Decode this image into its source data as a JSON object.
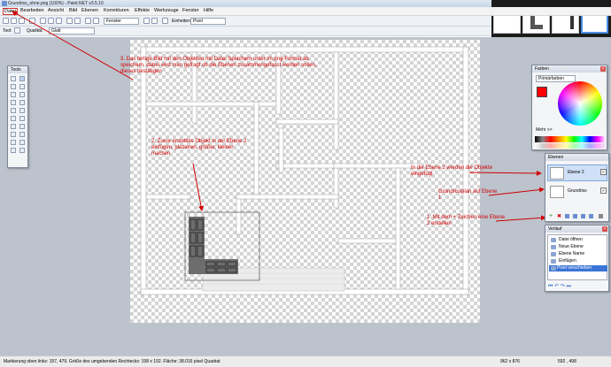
{
  "window": {
    "title": "Grundriss_ohne.png (100%) - Paint.NET v3.5.10"
  },
  "menu": [
    "Datei",
    "Bearbeiten",
    "Ansicht",
    "Bild",
    "Ebenen",
    "Korrekturen",
    "Effekte",
    "Werkzeuge",
    "Fenster",
    "Hilfe"
  ],
  "toolbar": {
    "view_combo": "Fenster",
    "units_label": "Einheiten:",
    "units_value": "Pixel"
  },
  "toolbar2": {
    "tool_label": "Tool:",
    "quality_label": "Qualität:",
    "quality_value": "Glatt"
  },
  "tools_panel": {
    "title": "Tools"
  },
  "colors_panel": {
    "title": "Farben",
    "mode": "Primärfarben",
    "more": "Mehr >>",
    "primary": "#ff0000",
    "secondary": "#000000"
  },
  "layers_panel": {
    "title": "Ebenen",
    "layers": [
      {
        "name": "Ebene 2",
        "checked": "✓"
      },
      {
        "name": "Grundriss",
        "checked": "✓"
      }
    ]
  },
  "history_panel": {
    "title": "Verlauf",
    "items": [
      "Datei öffnen",
      "Neue Ebene",
      "Ebene Name",
      "Einfügen",
      "Pixel verschieben"
    ]
  },
  "annotations": {
    "note3": "3. Das fertige Bild mit den Objekten mit Datei Speichern unter im png-Format ab speichern, dabei wird man gefragt ob die Ebenen zusammengefasst werden sollen, dieses bestätigen",
    "note2": "2. Zuvor erstelltes Objekt in der Ebene 2 einfügen, plazieren, größer, kleiner machen",
    "note_ebene2": "In die Ebene 2 werden die Objekte eingefügt",
    "note_grundriss": "Grundrissplan auf Ebene 1",
    "note1": "1. Mit dem + Zeichen eine Ebene 2 erstellen"
  },
  "status": {
    "left": "Markierung oben links: 157, 479. Größe des umgebenden Rechtecks: 198 x 192. Fläche: 38.016 pixel Quadrat",
    "size": "962 x 876",
    "pos": "592 , 498"
  },
  "accent": "#d00000"
}
